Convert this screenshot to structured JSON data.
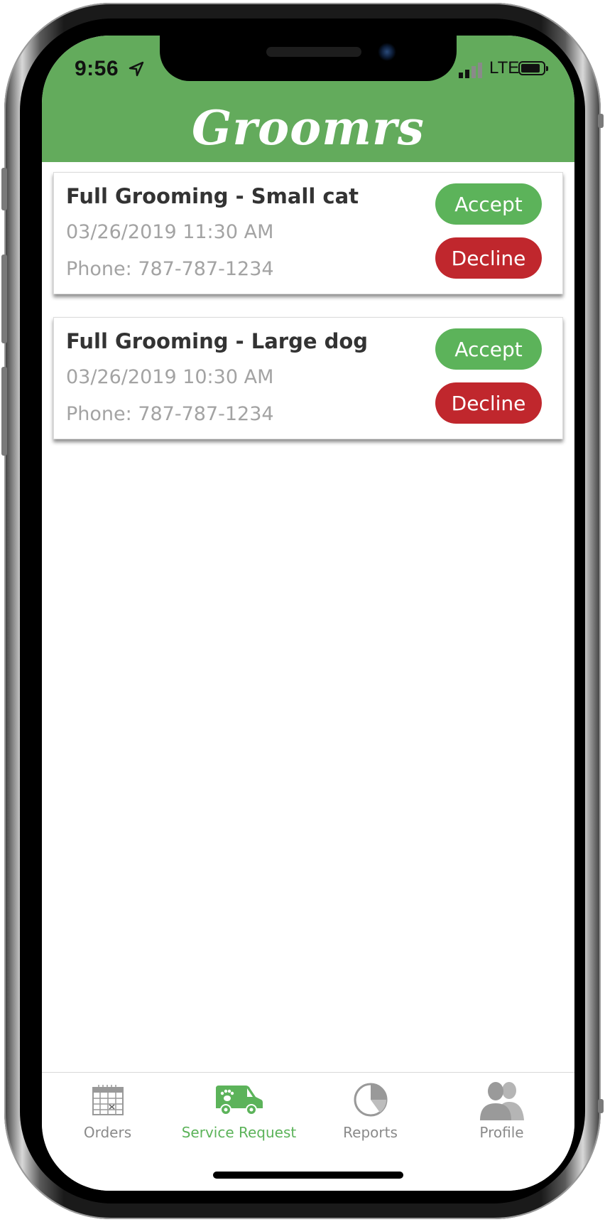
{
  "status_bar": {
    "time": "9:56",
    "network": "LTE"
  },
  "header": {
    "logo_text": "Groomrs",
    "color": "#63ab5c"
  },
  "requests": [
    {
      "title": "Full Grooming - Small cat",
      "datetime": "03/26/2019 11:30 AM",
      "phone": "Phone: 787-787-1234",
      "accept_label": "Accept",
      "decline_label": "Decline"
    },
    {
      "title": "Full Grooming - Large dog",
      "datetime": "03/26/2019 10:30 AM",
      "phone": "Phone: 787-787-1234",
      "accept_label": "Accept",
      "decline_label": "Decline"
    }
  ],
  "tabs": [
    {
      "label": "Orders",
      "icon": "calendar-icon",
      "active": false
    },
    {
      "label": "Service Request",
      "icon": "van-icon",
      "active": true
    },
    {
      "label": "Reports",
      "icon": "pie-chart-icon",
      "active": false
    },
    {
      "label": "Profile",
      "icon": "users-icon",
      "active": false
    }
  ],
  "colors": {
    "accent": "#5cb35a",
    "decline": "#c0272d",
    "muted_text": "#a3a3a3",
    "inactive_tab": "#8a8a8a"
  }
}
